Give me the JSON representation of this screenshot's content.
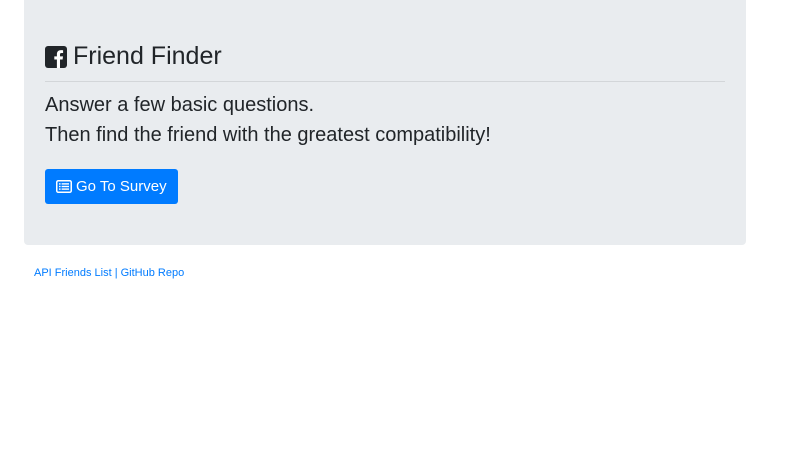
{
  "header": {
    "title": "Friend Finder",
    "icon": "facebook-square-icon"
  },
  "intro": {
    "line1": "Answer a few basic questions.",
    "line2": "Then find the friend with the greatest compatibility!"
  },
  "survey_button": {
    "label": "Go To Survey",
    "icon": "list-alt-icon"
  },
  "footer": {
    "api_link": "API Friends List",
    "separator": "|",
    "github_link": "GitHub Repo"
  },
  "colors": {
    "jumbotron_bg": "#e9ecef",
    "primary": "#007bff",
    "text": "#212529"
  }
}
